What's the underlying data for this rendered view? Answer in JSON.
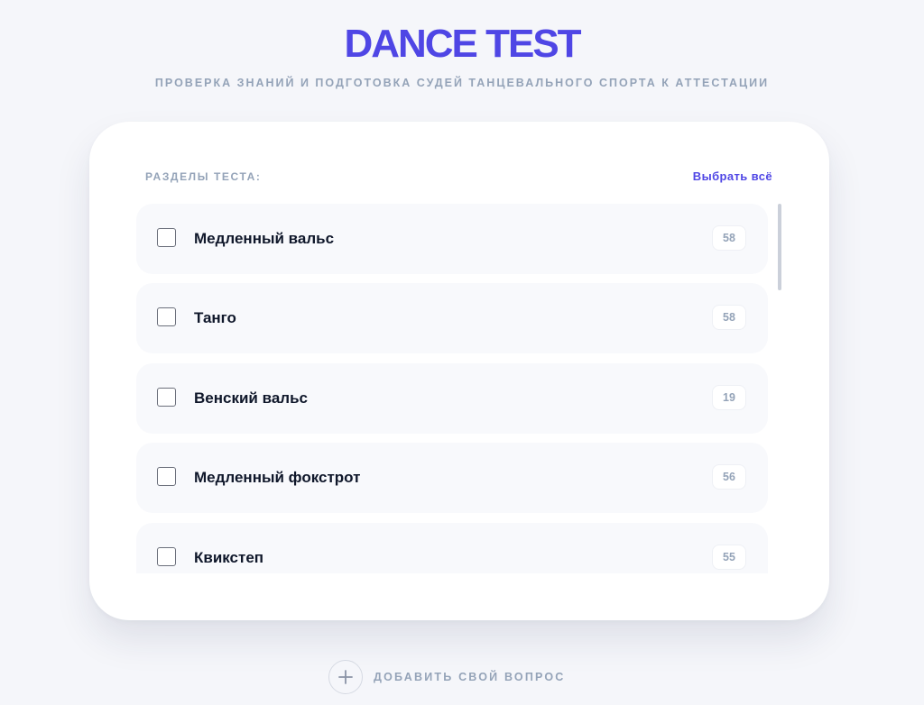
{
  "header": {
    "title": "DANCE TEST",
    "subtitle": "ПРОВЕРКА ЗНАНИЙ И ПОДГОТОВКА СУДЕЙ ТАНЦЕВАЛЬНОГО СПОРТА К АТТЕСТАЦИИ"
  },
  "sections": {
    "label": "РАЗДЕЛЫ ТЕСТА:",
    "select_all": "Выбрать всё",
    "items": [
      {
        "label": "Медленный вальс",
        "count": "58",
        "checked": false
      },
      {
        "label": "Танго",
        "count": "58",
        "checked": false
      },
      {
        "label": "Венский вальс",
        "count": "19",
        "checked": false
      },
      {
        "label": "Медленный фокстрот",
        "count": "56",
        "checked": false
      },
      {
        "label": "Квикстеп",
        "count": "55",
        "checked": false
      }
    ]
  },
  "footer": {
    "add_question": "ДОБАВИТЬ СВОЙ ВОПРОС",
    "add_icon": "plus-icon"
  },
  "colors": {
    "accent": "#4f46e5",
    "muted": "#94a3b8",
    "text": "#0f172a",
    "background": "#f5f6fa"
  }
}
